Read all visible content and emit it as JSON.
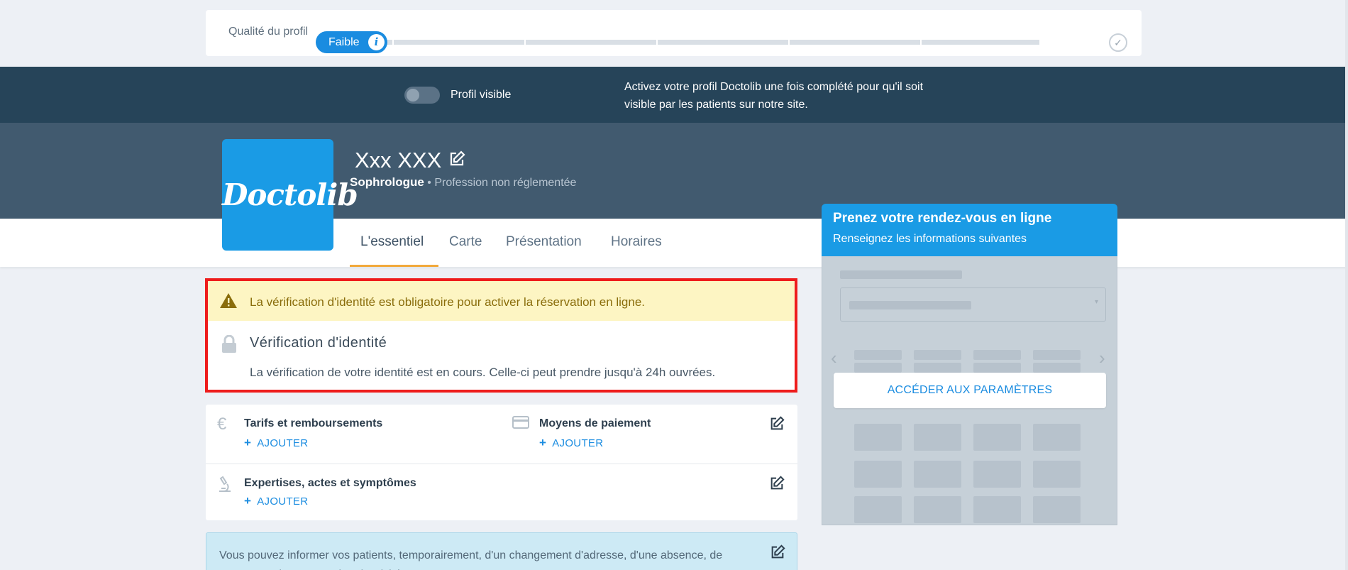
{
  "quality": {
    "label": "Qualité du profil",
    "level": "Faible",
    "progress_fraction": 0.07,
    "segments": 6
  },
  "visibility": {
    "toggle_label": "Profil visible",
    "toggle_on": false,
    "note": "Activez votre profil Doctolib une fois complété pour qu'il soit visible par les patients sur notre site."
  },
  "profile": {
    "logo_text": "Doctolib",
    "name": "Xxx XXX",
    "role": "Sophrologue",
    "role_detail": " • Profession non réglementée"
  },
  "tabs": [
    {
      "label": "L'essentiel",
      "active": true
    },
    {
      "label": "Carte",
      "active": false
    },
    {
      "label": "Présentation",
      "active": false
    },
    {
      "label": "Horaires",
      "active": false
    }
  ],
  "verification": {
    "warning": "La vérification d'identité est obligatoire pour activer la réservation en ligne.",
    "title": "Vérification d'identité",
    "description": "La vérification de votre identité est en cours. Celle-ci peut prendre jusqu'à 24h ouvrées."
  },
  "info_blocks": {
    "tarifs": {
      "title": "Tarifs et remboursements",
      "add_label": "AJOUTER",
      "icon": "euro-icon"
    },
    "paiement": {
      "title": "Moyens de paiement",
      "add_label": "AJOUTER",
      "icon": "credit-card-icon"
    },
    "expertises": {
      "title": "Expertises, actes et symptômes",
      "add_label": "AJOUTER",
      "icon": "microscope-icon"
    }
  },
  "notice": {
    "text": "Vous pouvez informer vos patients, temporairement, d'un changement d'adresse, d'une absence, de travaux ou d'une cessation d'activité."
  },
  "booking": {
    "title": "Prenez votre rendez-vous en ligne",
    "subtitle": "Renseignez les informations suivantes",
    "button_label": "ACCÉDER AUX PARAMÈTRES"
  },
  "colors": {
    "accent": "#1a9be5",
    "header_dark": "#264459",
    "header_mid": "#415a6f",
    "warning_bg": "#fdf5c3",
    "highlight_border": "#ee1c1c",
    "tab_underline": "#f2a93b"
  }
}
